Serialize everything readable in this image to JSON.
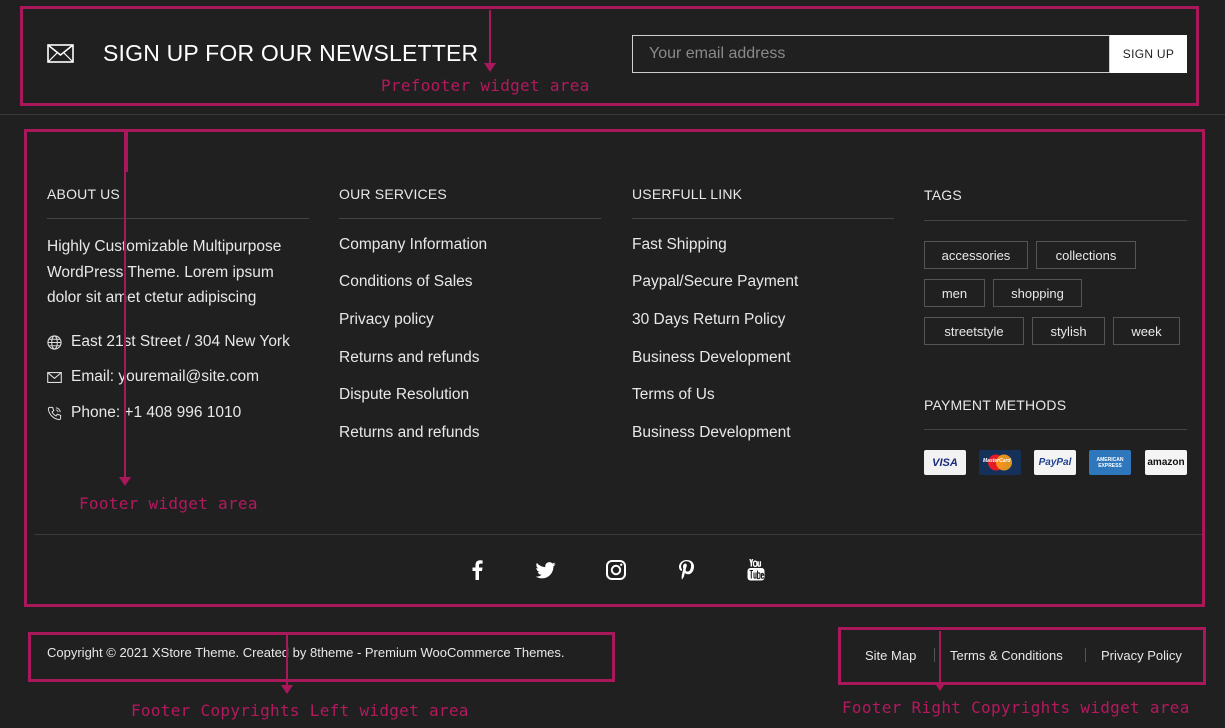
{
  "newsletter": {
    "icon": "envelope-icon",
    "title": "SIGN UP FOR OUR NEWSLETTER",
    "email_placeholder": "Your email address",
    "button_label": "SIGN UP"
  },
  "annotations": {
    "prefooter": "Prefooter widget area",
    "footer": "Footer widget area",
    "copyrights_left": "Footer Copyrights Left widget area",
    "copyrights_right": "Footer Right Copyrights widget area"
  },
  "about": {
    "heading": "ABOUT US",
    "text": "Highly Customizable Multipurpose WordPress Theme. Lorem ipsum dolor sit amet ctetur adipiscing",
    "address": "East 21st Street / 304 New York",
    "email": "Email: youremail@site.com",
    "phone": "Phone: +1 408 996 1010"
  },
  "services": {
    "heading": "OUR SERVICES",
    "links": [
      "Company Information",
      "Conditions of Sales",
      "Privacy policy",
      "Returns and refunds",
      "Dispute Resolution",
      "Returns and refunds"
    ]
  },
  "useful": {
    "heading": "USERFULL LINK",
    "links": [
      "Fast Shipping",
      "Paypal/Secure Payment",
      "30 Days Return Policy",
      "Business Development",
      "Terms of Us",
      "Business Development"
    ]
  },
  "tags": {
    "heading": "TAGS",
    "items": [
      "accessories",
      "collections",
      "men",
      "shopping",
      "streetstyle",
      "stylish",
      "week"
    ]
  },
  "payment": {
    "heading": "PAYMENT METHODS",
    "methods": [
      "VISA",
      "MasterCard",
      "PayPal",
      "AMERICAN EXPRESS",
      "amazon"
    ]
  },
  "social": [
    "facebook-icon",
    "twitter-icon",
    "instagram-icon",
    "pinterest-icon",
    "youtube-icon"
  ],
  "copyright": "Copyright © 2021 XStore Theme. Created by 8theme - Premium WooCommerce Themes.",
  "footer_links": [
    "Site Map",
    "Terms & Conditions",
    "Privacy Policy"
  ],
  "colors": {
    "background": "#202020",
    "annotation": "#a8185a",
    "text": "#e8e8e8"
  }
}
